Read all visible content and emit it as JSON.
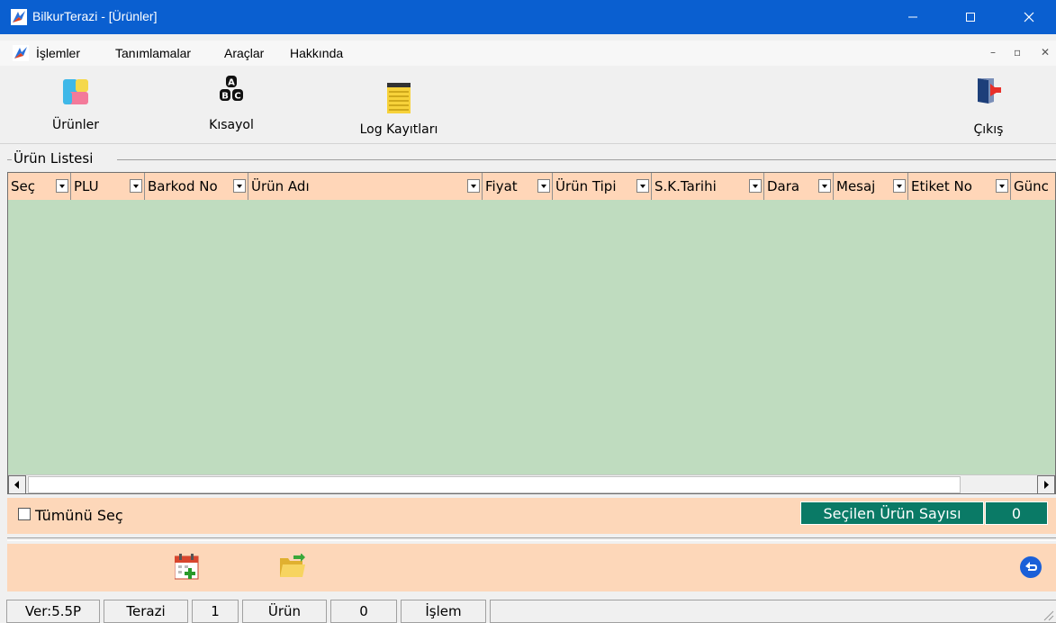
{
  "window": {
    "title": "BilkurTerazi  - [Ürünler]"
  },
  "menu": {
    "items": [
      "İşlemler",
      "Tanımlamalar",
      "Araçlar",
      "Hakkında"
    ]
  },
  "toolbar": {
    "products_label": "Ürünler",
    "shortcut_label": "Kısayol",
    "log_label": "Log Kayıtları",
    "exit_label": "Çıkış"
  },
  "group": {
    "title": "Ürün Listesi"
  },
  "grid": {
    "columns": [
      "Seç",
      "PLU",
      "Barkod No",
      "Ürün Adı",
      "Fiyat",
      "Ürün Tipi",
      "S.K.Tarihi",
      "Dara",
      "Mesaj",
      "Etiket No",
      "Günc"
    ],
    "rows": []
  },
  "selection": {
    "select_all_label": "Tümünü Seç",
    "count_label": "Seçilen Ürün Sayısı",
    "count_value": "0"
  },
  "status": {
    "version": "Ver:5.5P",
    "scale_label": "Terazi",
    "scale_value": "1",
    "product_label": "Ürün",
    "product_value": "0",
    "operation_label": "İşlem"
  },
  "colors": {
    "titlebar": "#0a5fd0",
    "header": "#ffd6b8",
    "grid_body": "#bfdcbf",
    "panel": "#fdd7b9",
    "count_bg": "#0a7a66"
  },
  "icons": {
    "products": "colored-blocks-icon",
    "shortcut": "abc-blocks-icon",
    "log": "notepad-icon",
    "exit": "exit-door-icon",
    "add": "calendar-add-icon",
    "open": "open-folder-icon",
    "back": "back-arrow-icon"
  }
}
